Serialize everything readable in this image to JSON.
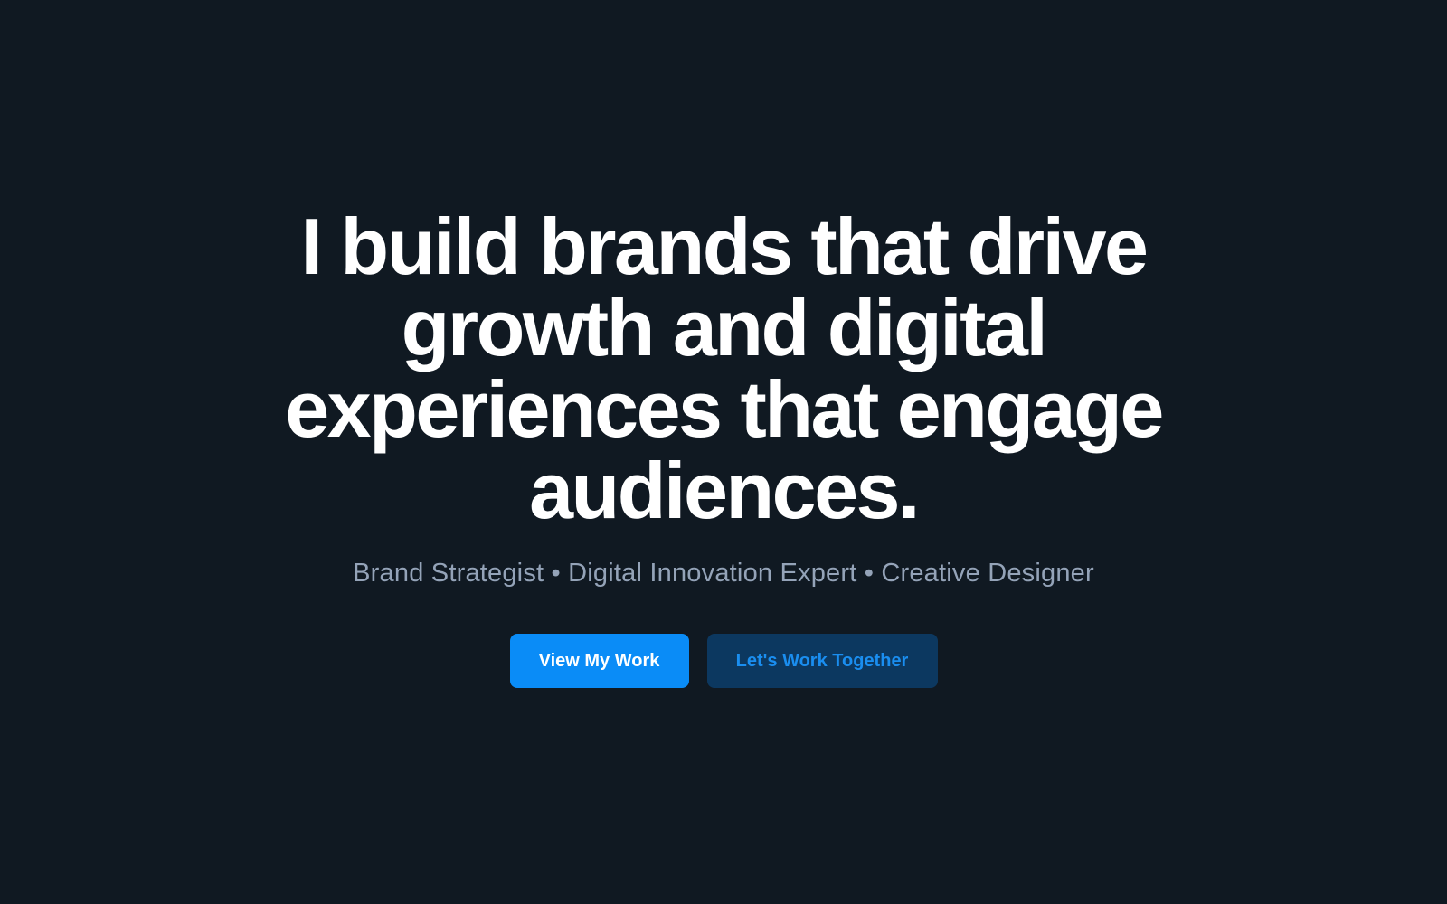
{
  "hero": {
    "headline": "I build brands that drive growth and digital experiences that engage audiences.",
    "subtitle": "Brand Strategist • Digital Innovation Expert • Creative Designer",
    "primary_button": "View My Work",
    "secondary_button": "Let's Work Together"
  },
  "colors": {
    "background": "#101922",
    "accent": "#0a8cf7",
    "secondary_bg": "#0c3860"
  }
}
